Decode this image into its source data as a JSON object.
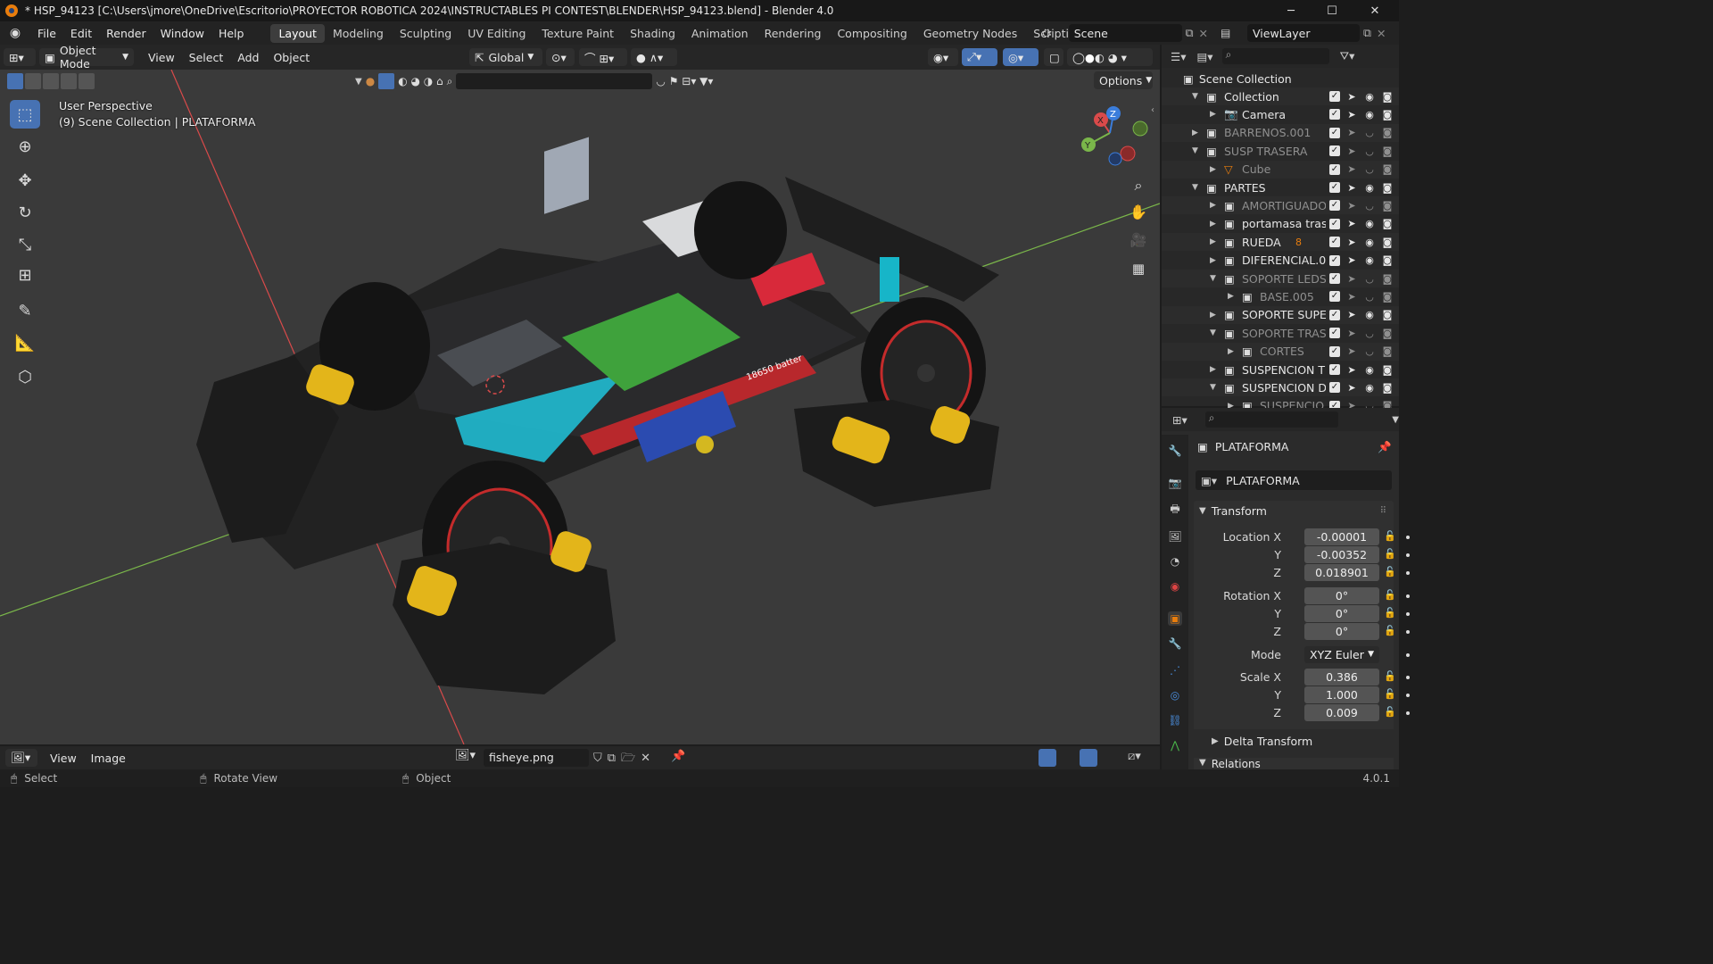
{
  "window": {
    "title": "* HSP_94123 [C:\\Users\\jmore\\OneDrive\\Escritorio\\PROYECTOR ROBOTICA 2024\\INSTRUCTABLES PI CONTEST\\BLENDER\\HSP_94123.blend] - Blender 4.0",
    "minimize": "─",
    "maximize": "☐",
    "close": "✕"
  },
  "menubar": {
    "items": [
      "File",
      "Edit",
      "Render",
      "Window",
      "Help"
    ],
    "workspaces": [
      "Layout",
      "Modeling",
      "Sculpting",
      "UV Editing",
      "Texture Paint",
      "Shading",
      "Animation",
      "Rendering",
      "Compositing",
      "Geometry Nodes",
      "Scripting"
    ],
    "add_tab": "+",
    "scene": "Scene",
    "view_layer": "ViewLayer"
  },
  "viewport_header": {
    "mode": "Object Mode",
    "menus": [
      "View",
      "Select",
      "Add",
      "Object"
    ],
    "orientation": "Global",
    "options": "Options"
  },
  "viewport": {
    "perspective": "User Perspective",
    "collection_info": "(9) Scene Collection | PLATAFORMA",
    "gizmo": {
      "x": "X",
      "y": "Y",
      "z": "Z"
    },
    "model_labels": {
      "battery": "18650 batter"
    }
  },
  "image_editor_header": {
    "menus": [
      "View",
      "Image"
    ],
    "image_name": "fisheye.png"
  },
  "statusbar": {
    "select": "Select",
    "rotate": "Rotate View",
    "object": "Object",
    "version": "4.0.1"
  },
  "outliner": {
    "root": "Scene Collection",
    "rows": [
      {
        "label": "Collection",
        "indent": 1,
        "expanded": true,
        "dim": false
      },
      {
        "label": "Camera",
        "indent": 2,
        "expanded": false,
        "dim": false
      },
      {
        "label": "BARRENOS.001",
        "indent": 1,
        "expanded": false,
        "dim": true
      },
      {
        "label": "SUSP TRASERA",
        "indent": 1,
        "expanded": true,
        "dim": true
      },
      {
        "label": "Cube",
        "indent": 2,
        "expanded": false,
        "dim": true
      },
      {
        "label": "PARTES",
        "indent": 1,
        "expanded": true,
        "dim": false
      },
      {
        "label": "AMORTIGUADO",
        "indent": 2,
        "expanded": false,
        "dim": true
      },
      {
        "label": "portamasa trase",
        "indent": 2,
        "expanded": false,
        "dim": false
      },
      {
        "label": "RUEDA",
        "indent": 2,
        "expanded": false,
        "dim": false
      },
      {
        "label": "DIFERENCIAL.0",
        "indent": 2,
        "expanded": false,
        "dim": false
      },
      {
        "label": "SOPORTE LEDS",
        "indent": 2,
        "expanded": true,
        "dim": true
      },
      {
        "label": "BASE.005",
        "indent": 3,
        "expanded": false,
        "dim": true
      },
      {
        "label": "SOPORTE SUPE",
        "indent": 2,
        "expanded": false,
        "dim": false
      },
      {
        "label": "SOPORTE TRAS",
        "indent": 2,
        "expanded": true,
        "dim": true
      },
      {
        "label": "CORTES",
        "indent": 3,
        "expanded": false,
        "dim": true
      },
      {
        "label": "SUSPENCION TI",
        "indent": 2,
        "expanded": false,
        "dim": false
      },
      {
        "label": "SUSPENCION DI",
        "indent": 2,
        "expanded": true,
        "dim": false
      },
      {
        "label": "SUSPENCIO",
        "indent": 3,
        "expanded": false,
        "dim": true
      }
    ],
    "rueda_badge": "8"
  },
  "properties": {
    "object_name": "PLATAFORMA",
    "data_name": "PLATAFORMA",
    "transform_label": "Transform",
    "location_label": "Location X",
    "location": [
      "-0.00001",
      "-0.00352",
      "0.018901"
    ],
    "rotation_label": "Rotation X",
    "rotation": [
      "0°",
      "0°",
      "0°"
    ],
    "mode_label": "Mode",
    "mode": "XYZ Euler",
    "scale_label": "Scale X",
    "scale": [
      "0.386",
      "1.000",
      "0.009"
    ],
    "axis_y": "Y",
    "axis_z": "Z",
    "delta_transform": "Delta Transform",
    "relations": "Relations"
  },
  "colors": {
    "accent": "#4772b3",
    "axis_x": "#d94a4a",
    "axis_y": "#7ab64a",
    "axis_z": "#3b7ddb",
    "orange": "#e87d0d"
  }
}
